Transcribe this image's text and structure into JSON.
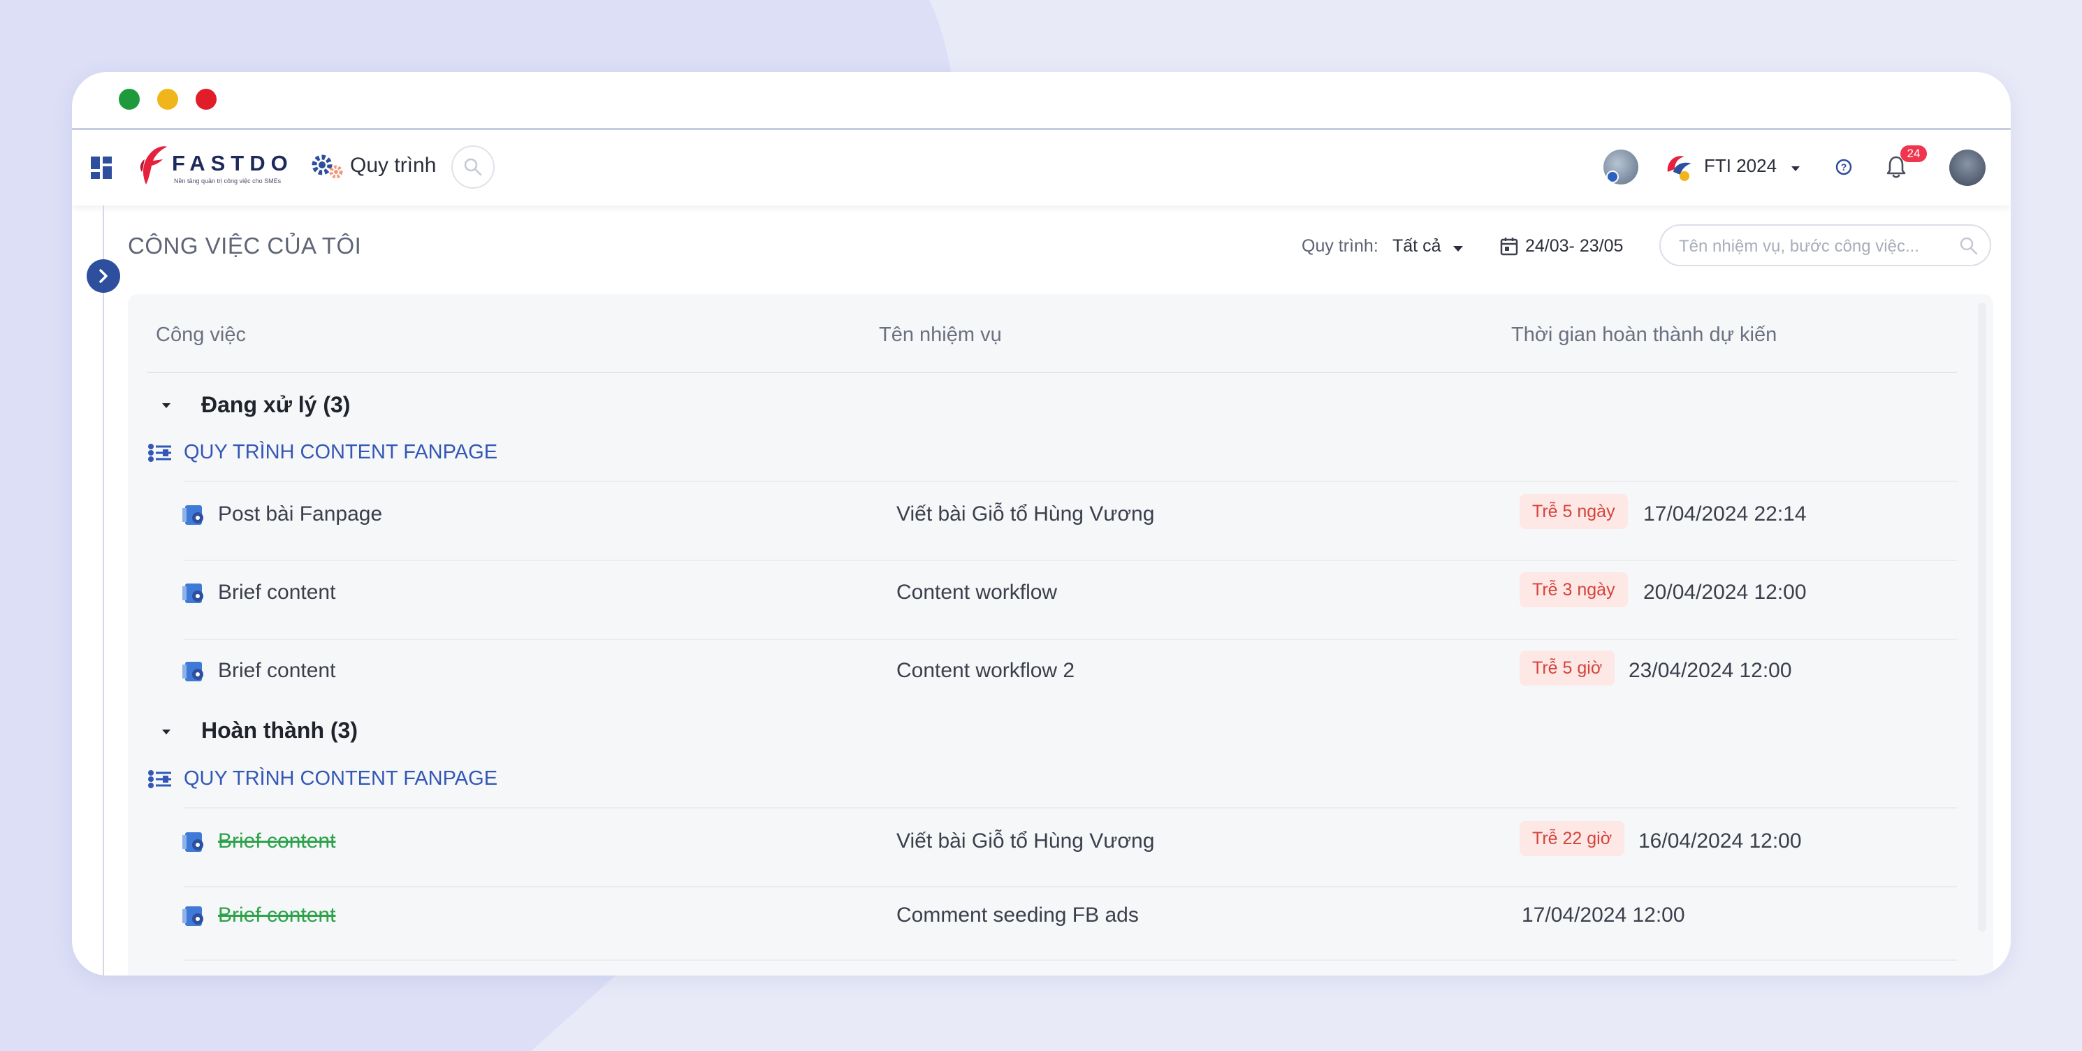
{
  "app": {
    "brand": "FASTDO",
    "tagline": "Nền tảng quản trị công việc cho SMEs",
    "module": "Quy trình"
  },
  "header": {
    "org": "FTI 2024",
    "notifications": "24"
  },
  "page": {
    "title": "CÔNG VIỆC CỦA TÔI",
    "filter_label": "Quy trình:",
    "filter_value": "Tất cả",
    "date_range": "24/03- 23/05",
    "search_placeholder": "Tên nhiệm vụ, bước công việc..."
  },
  "table": {
    "columns": [
      "Công việc",
      "Tên nhiệm vụ",
      "Thời gian hoàn thành dự kiến"
    ],
    "groups": [
      {
        "title": "Đang xử lý (3)",
        "process": "QUY TRÌNH CONTENT FANPAGE",
        "rows": [
          {
            "task": "Post bài Fanpage",
            "mission": "Viết bài Giỗ tổ Hùng Vương",
            "late": "Trễ 5 ngày",
            "due": "17/04/2024 22:14"
          },
          {
            "task": "Brief content",
            "mission": "Content workflow",
            "late": "Trễ 3 ngày",
            "due": "20/04/2024 12:00"
          },
          {
            "task": "Brief content",
            "mission": "Content workflow 2",
            "late": "Trễ 5 giờ",
            "due": "23/04/2024 12:00"
          }
        ]
      },
      {
        "title": "Hoàn thành (3)",
        "process": "QUY TRÌNH CONTENT FANPAGE",
        "rows": [
          {
            "task": "Brief content",
            "mission": "Viết bài Giỗ tổ Hùng Vương",
            "late": "Trễ 22 giờ",
            "due": "16/04/2024 12:00"
          },
          {
            "task": "Brief content",
            "mission": "Comment seeding FB ads",
            "due": "17/04/2024 12:00"
          }
        ]
      }
    ]
  },
  "colors": {
    "accent": "#3357b5",
    "late_bg": "#fde8e6",
    "late_text": "#d5433a",
    "done_text": "#2ca24a",
    "badge": "#f0354f"
  }
}
